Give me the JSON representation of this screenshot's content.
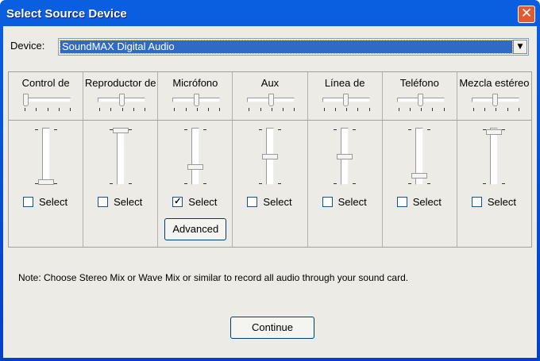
{
  "window": {
    "title": "Select Source Device",
    "close_icon": "close-icon"
  },
  "device": {
    "label": "Device:",
    "value": "SoundMAX Digital Audio"
  },
  "columns": [
    {
      "name": "Control de",
      "volume": 0.0,
      "balance": 0.0,
      "selected": false,
      "select_label": "Select"
    },
    {
      "name": "Reproductor de",
      "volume": 1.0,
      "balance": 0.5,
      "selected": false,
      "select_label": "Select"
    },
    {
      "name": "Micrófono",
      "volume": 0.3,
      "balance": 0.5,
      "selected": true,
      "select_label": "Select",
      "advanced_label": "Advanced"
    },
    {
      "name": "Aux",
      "volume": 0.5,
      "balance": 0.5,
      "selected": false,
      "select_label": "Select"
    },
    {
      "name": "Línea de",
      "volume": 0.5,
      "balance": 0.5,
      "selected": false,
      "select_label": "Select"
    },
    {
      "name": "Teléfono",
      "volume": 0.12,
      "balance": 0.5,
      "selected": false,
      "select_label": "Select"
    },
    {
      "name": "Mezcla estéreo",
      "volume": 0.97,
      "balance": 0.5,
      "selected": false,
      "select_label": "Select"
    }
  ],
  "note": "Note: Choose Stereo Mix or Wave Mix or similar to record all audio through your sound card.",
  "continue_label": "Continue"
}
